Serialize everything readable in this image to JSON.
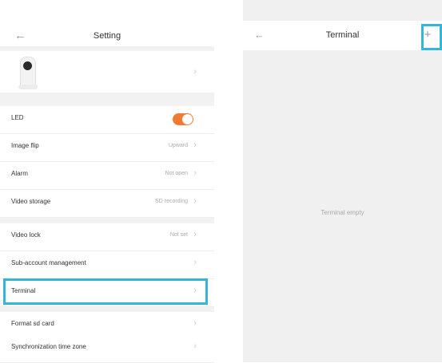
{
  "colors": {
    "accent_toggle": "#f07b32",
    "highlight": "#33b6da"
  },
  "left": {
    "back_icon": "arrow-left-icon",
    "title": "Setting",
    "rows": [
      {
        "label": "LED",
        "toggle_on": true
      },
      {
        "label": "Image flip",
        "value": "Upward"
      },
      {
        "label": "Alarm",
        "value": "Not open"
      },
      {
        "label": "Video storage",
        "value": "SD recording"
      },
      {
        "label": "Video lock",
        "value": "Not set"
      },
      {
        "label": "Sub-account management"
      },
      {
        "label": "Terminal"
      },
      {
        "label": "Format sd card"
      },
      {
        "label": "Synchronization time zone"
      }
    ]
  },
  "right": {
    "back_icon": "arrow-left-icon",
    "title": "Terminal",
    "add_icon": "plus-icon",
    "empty_text": "Terminal empty"
  }
}
